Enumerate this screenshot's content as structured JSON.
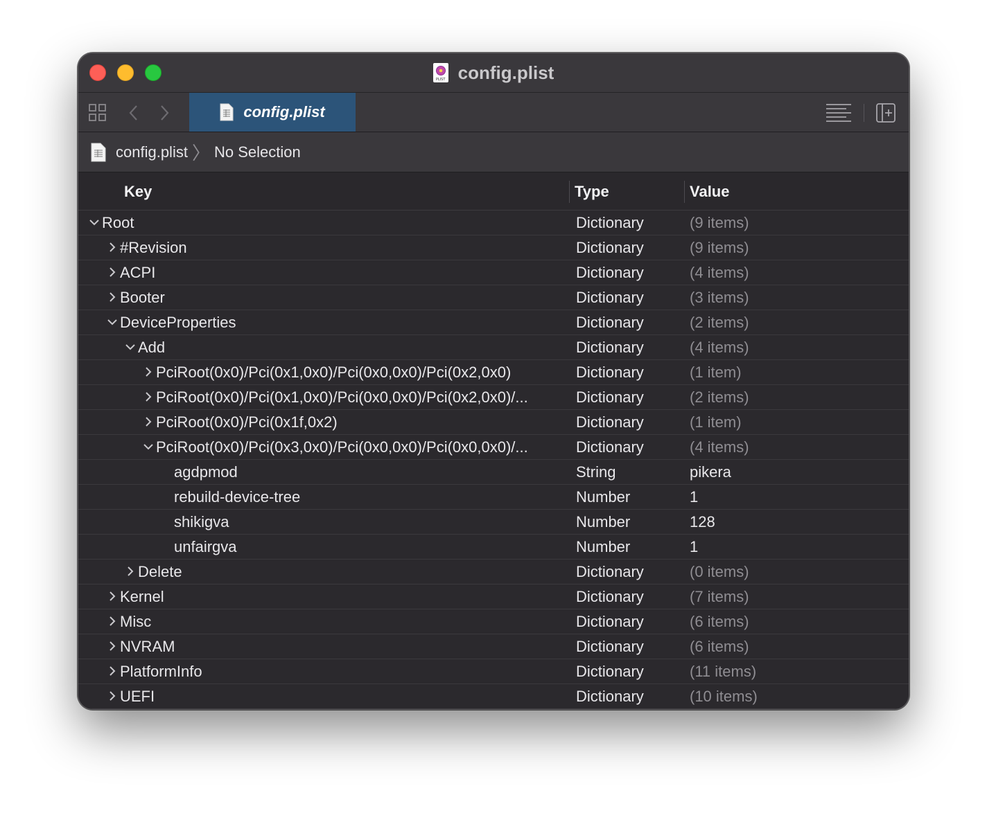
{
  "window": {
    "title": "config.plist",
    "title_icon_label": "PLIST"
  },
  "toolbar": {
    "tab_label": "config.plist"
  },
  "breadcrumb": {
    "file": "config.plist",
    "selection": "No Selection"
  },
  "table": {
    "headers": {
      "key": "Key",
      "type": "Type",
      "value": "Value"
    },
    "rows": [
      {
        "level": 0,
        "disclosure": "open",
        "key": "Root",
        "type": "Dictionary",
        "value": "(9 items)",
        "muted": true
      },
      {
        "level": 1,
        "disclosure": "closed",
        "key": "#Revision",
        "type": "Dictionary",
        "value": "(9 items)",
        "muted": true
      },
      {
        "level": 1,
        "disclosure": "closed",
        "key": "ACPI",
        "type": "Dictionary",
        "value": "(4 items)",
        "muted": true
      },
      {
        "level": 1,
        "disclosure": "closed",
        "key": "Booter",
        "type": "Dictionary",
        "value": "(3 items)",
        "muted": true
      },
      {
        "level": 1,
        "disclosure": "open",
        "key": "DeviceProperties",
        "type": "Dictionary",
        "value": "(2 items)",
        "muted": true
      },
      {
        "level": 2,
        "disclosure": "open",
        "key": "Add",
        "type": "Dictionary",
        "value": "(4 items)",
        "muted": true
      },
      {
        "level": 3,
        "disclosure": "closed",
        "key": "PciRoot(0x0)/Pci(0x1,0x0)/Pci(0x0,0x0)/Pci(0x2,0x0)",
        "type": "Dictionary",
        "value": "(1 item)",
        "muted": true
      },
      {
        "level": 3,
        "disclosure": "closed",
        "key": "PciRoot(0x0)/Pci(0x1,0x0)/Pci(0x0,0x0)/Pci(0x2,0x0)/...",
        "type": "Dictionary",
        "value": "(2 items)",
        "muted": true
      },
      {
        "level": 3,
        "disclosure": "closed",
        "key": "PciRoot(0x0)/Pci(0x1f,0x2)",
        "type": "Dictionary",
        "value": "(1 item)",
        "muted": true
      },
      {
        "level": 3,
        "disclosure": "open",
        "key": "PciRoot(0x0)/Pci(0x3,0x0)/Pci(0x0,0x0)/Pci(0x0,0x0)/...",
        "type": "Dictionary",
        "value": "(4 items)",
        "muted": true
      },
      {
        "level": 4,
        "disclosure": "none",
        "key": "agdpmod",
        "type": "String",
        "value": "pikera",
        "muted": false
      },
      {
        "level": 4,
        "disclosure": "none",
        "key": "rebuild-device-tree",
        "type": "Number",
        "value": "1",
        "muted": false
      },
      {
        "level": 4,
        "disclosure": "none",
        "key": "shikigva",
        "type": "Number",
        "value": "128",
        "muted": false
      },
      {
        "level": 4,
        "disclosure": "none",
        "key": "unfairgva",
        "type": "Number",
        "value": "1",
        "muted": false
      },
      {
        "level": 2,
        "disclosure": "closed",
        "key": "Delete",
        "type": "Dictionary",
        "value": "(0 items)",
        "muted": true
      },
      {
        "level": 1,
        "disclosure": "closed",
        "key": "Kernel",
        "type": "Dictionary",
        "value": "(7 items)",
        "muted": true
      },
      {
        "level": 1,
        "disclosure": "closed",
        "key": "Misc",
        "type": "Dictionary",
        "value": "(6 items)",
        "muted": true
      },
      {
        "level": 1,
        "disclosure": "closed",
        "key": "NVRAM",
        "type": "Dictionary",
        "value": "(6 items)",
        "muted": true
      },
      {
        "level": 1,
        "disclosure": "closed",
        "key": "PlatformInfo",
        "type": "Dictionary",
        "value": "(11 items)",
        "muted": true
      },
      {
        "level": 1,
        "disclosure": "closed",
        "key": "UEFI",
        "type": "Dictionary",
        "value": "(10 items)",
        "muted": true
      }
    ]
  },
  "icons": {
    "close": "close-button",
    "minimize": "minimize-button",
    "zoom": "zoom-button",
    "grid": "related-items-icon",
    "back": "chevron-left-icon",
    "forward": "chevron-right-icon",
    "file": "plist-file-icon",
    "lines": "editor-options-icon",
    "add_editor": "add-editor-icon"
  },
  "colors": {
    "tab_active": "#2c5479",
    "close": "#fe5f57",
    "minimize": "#febc2e",
    "zoom": "#28c840"
  }
}
